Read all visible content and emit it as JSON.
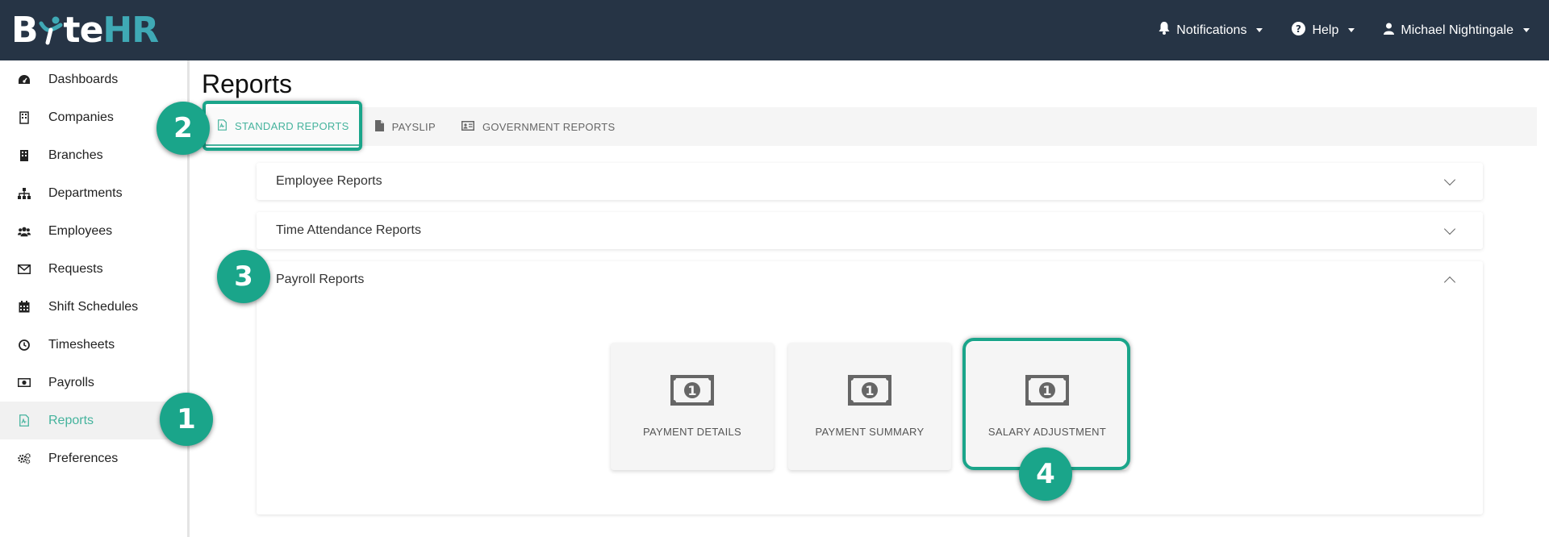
{
  "app": {
    "logo_b": "B",
    "logo_te": "te",
    "logo_hr": "HR"
  },
  "topnav": {
    "notifications": "Notifications",
    "help": "Help",
    "user": "Michael Nightingale"
  },
  "sidebar": {
    "items": [
      {
        "label": "Dashboards",
        "icon": "dashboard-icon"
      },
      {
        "label": "Companies",
        "icon": "building-icon"
      },
      {
        "label": "Branches",
        "icon": "branch-building-icon"
      },
      {
        "label": "Departments",
        "icon": "sitemap-icon"
      },
      {
        "label": "Employees",
        "icon": "users-icon"
      },
      {
        "label": "Requests",
        "icon": "envelope-icon"
      },
      {
        "label": "Shift Schedules",
        "icon": "calendar-icon"
      },
      {
        "label": "Timesheets",
        "icon": "clock-icon"
      },
      {
        "label": "Payrolls",
        "icon": "money-bill-icon"
      },
      {
        "label": "Reports",
        "icon": "file-pdf-icon",
        "active": true
      },
      {
        "label": "Preferences",
        "icon": "cogs-icon"
      }
    ]
  },
  "main": {
    "title": "Reports",
    "tabs": [
      {
        "label": "STANDARD REPORTS",
        "icon": "file-pdf-icon",
        "active": true
      },
      {
        "label": "PAYSLIP",
        "icon": "file-icon"
      },
      {
        "label": "GOVERNMENT REPORTS",
        "icon": "id-card-icon"
      }
    ],
    "sections": [
      {
        "label": "Employee Reports",
        "expanded": false
      },
      {
        "label": "Time Attendance Reports",
        "expanded": false
      },
      {
        "label": "Payroll Reports",
        "expanded": true
      }
    ],
    "payroll_cards": [
      {
        "label": "PAYMENT DETAILS",
        "icon": "money-bill-icon"
      },
      {
        "label": "PAYMENT SUMMARY",
        "icon": "money-bill-icon"
      },
      {
        "label": "SALARY ADJUSTMENT",
        "icon": "money-bill-icon"
      }
    ]
  },
  "annotations": {
    "step1": "1",
    "step2": "2",
    "step3": "3",
    "step4": "4",
    "color": "#1aa58a"
  },
  "colors": {
    "topbar": "#263445",
    "accent": "#45b39d",
    "logo_hr": "#3fa9b5"
  }
}
